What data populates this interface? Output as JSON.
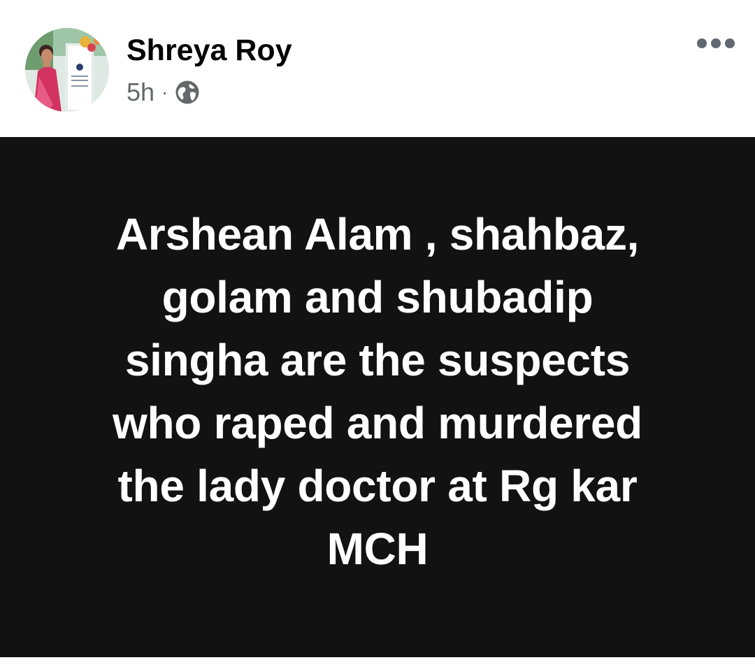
{
  "post": {
    "author": {
      "name": "Shreya Roy",
      "avatar_icon": "profile-photo"
    },
    "timestamp": "5h",
    "separator": "·",
    "audience_icon": "globe-icon",
    "more_icon": "more-options-icon",
    "text_card": {
      "background": "#121212",
      "text_color": "#ffffff",
      "text": "Arshean Alam , shahbaz,\ngolam and shubadip\nsingha are the suspects\nwho raped and murdered\nthe lady doctor at Rg kar\nMCH"
    }
  },
  "colors": {
    "name_text": "#050505",
    "meta_text": "#65676b",
    "icon_gray": "#606770"
  }
}
